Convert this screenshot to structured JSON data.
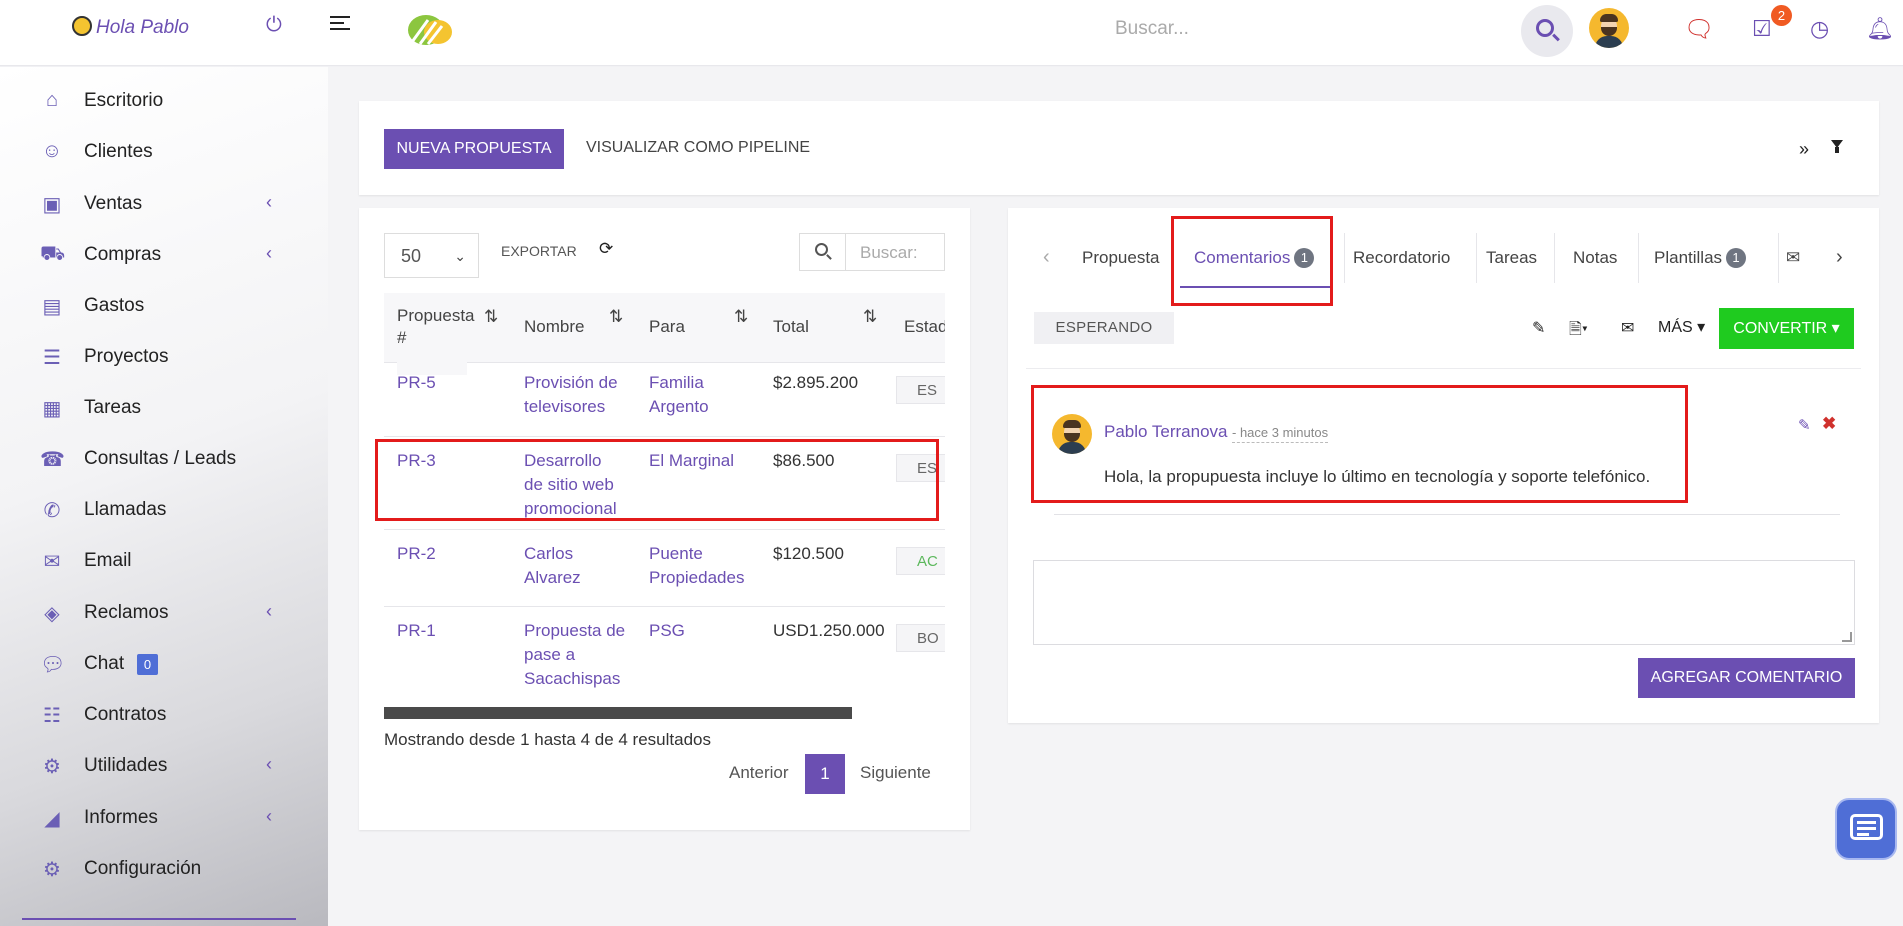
{
  "header": {
    "greeting": "Hola Pablo",
    "search_placeholder": "Buscar...",
    "tasks_badge": "2"
  },
  "sidebar": {
    "items": [
      {
        "label": "Escritorio",
        "icon": "home-icon",
        "chevron": false
      },
      {
        "label": "Clientes",
        "icon": "user-icon",
        "chevron": false
      },
      {
        "label": "Ventas",
        "icon": "money-icon",
        "chevron": true
      },
      {
        "label": "Compras",
        "icon": "cart-icon",
        "chevron": true
      },
      {
        "label": "Gastos",
        "icon": "file-icon",
        "chevron": false
      },
      {
        "label": "Proyectos",
        "icon": "bars-icon",
        "chevron": false
      },
      {
        "label": "Tareas",
        "icon": "tasks-icon",
        "chevron": false
      },
      {
        "label": "Consultas / Leads",
        "icon": "tty-icon",
        "chevron": false
      },
      {
        "label": "Llamadas",
        "icon": "phone-icon",
        "chevron": false
      },
      {
        "label": "Email",
        "icon": "envelope-icon",
        "chevron": false
      },
      {
        "label": "Reclamos",
        "icon": "ticket-icon",
        "chevron": true
      },
      {
        "label": "Chat",
        "icon": "comments-icon",
        "chevron": false,
        "badge": "0"
      },
      {
        "label": "Contratos",
        "icon": "list-icon",
        "chevron": false
      },
      {
        "label": "Utilidades",
        "icon": "cogs-icon",
        "chevron": true
      },
      {
        "label": "Informes",
        "icon": "chart-icon",
        "chevron": true
      },
      {
        "label": "Configuración",
        "icon": "gear-icon",
        "chevron": false
      }
    ]
  },
  "toolbar": {
    "new_label": "NUEVA PROPUESTA",
    "pipeline_label": "VISUALIZAR COMO PIPELINE",
    "expand_label": "»"
  },
  "list": {
    "page_size": "50",
    "export_label": "EXPORTAR",
    "search_placeholder": "Buscar:",
    "columns": [
      "Propuesta #",
      "Nombre",
      "Para",
      "Total",
      "Estad"
    ],
    "rows": [
      {
        "id": "PR-5",
        "nombre": "Provisión de televisores",
        "para": "Familia Argento",
        "total": "$2.895.200",
        "estado": "ES"
      },
      {
        "id": "PR-3",
        "nombre": "Desarrollo de sitio web promocional",
        "para": "El Marginal",
        "total": "$86.500",
        "estado": "ES"
      },
      {
        "id": "PR-2",
        "nombre": "Carlos Alvarez",
        "para": "Puente Propiedades",
        "total": "$120.500",
        "estado": "AC"
      },
      {
        "id": "PR-1",
        "nombre": "Propuesta de pase a Sacachispas",
        "para": "PSG",
        "total": "USD1.250.000",
        "estado": "BO"
      }
    ],
    "showing_text": "Mostrando desde 1 hasta 4 de 4 resultados",
    "prev_label": "Anterior",
    "current_page": "1",
    "next_label": "Siguiente"
  },
  "detail": {
    "tabs": [
      {
        "label": "Propuesta",
        "count": null
      },
      {
        "label": "Comentarios",
        "count": "1"
      },
      {
        "label": "Recordatorio",
        "count": null
      },
      {
        "label": "Tareas",
        "count": null
      },
      {
        "label": "Notas",
        "count": null
      },
      {
        "label": "Plantillas",
        "count": "1"
      }
    ],
    "status": "ESPERANDO",
    "more_label": "MÁS",
    "convert_label": "CONVERTIR",
    "comment": {
      "author": "Pablo Terranova",
      "time": "- hace 3 minutos",
      "text": "Hola, la propupuesta incluye lo último en tecnología y soporte telefónico."
    },
    "add_comment_label": "AGREGAR COMENTARIO"
  },
  "colors": {
    "accent": "#6b4fb2",
    "convert": "#1fcb1f",
    "highlight": "#e31b1b"
  }
}
